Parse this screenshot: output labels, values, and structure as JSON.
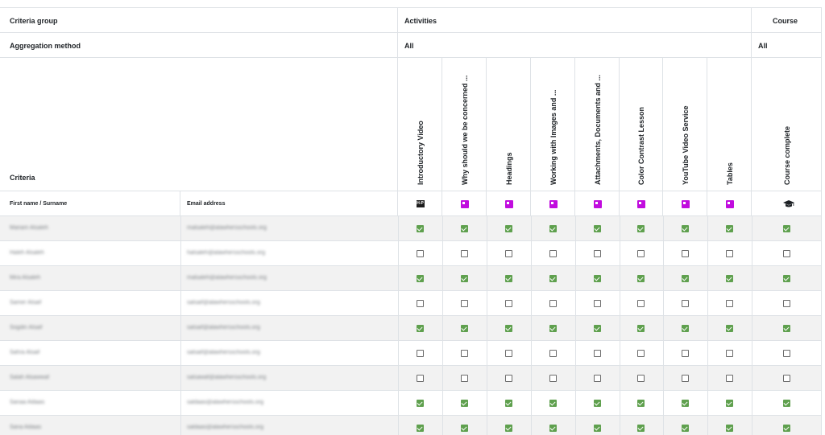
{
  "header": {
    "criteria_group_label": "Criteria group",
    "activities_label": "Activities",
    "course_label": "Course",
    "aggregation_method_label": "Aggregation method",
    "activities_aggregation": "All",
    "course_aggregation": "All",
    "criteria_label": "Criteria",
    "first_name_col": "First name / Surname",
    "email_col": "Email address"
  },
  "activities": [
    {
      "label": "Introductory Video",
      "icon": "h5p-icon"
    },
    {
      "label": "Why should we be concerned ...",
      "icon": "lesson-icon"
    },
    {
      "label": "Headings",
      "icon": "lesson-icon"
    },
    {
      "label": "Working with Images and ...",
      "icon": "lesson-icon"
    },
    {
      "label": "Attachments, Documents and ...",
      "icon": "lesson-icon"
    },
    {
      "label": "Color Contrast Lesson",
      "icon": "lesson-icon"
    },
    {
      "label": "YouTube Video Service",
      "icon": "lesson-icon"
    },
    {
      "label": "Tables",
      "icon": "lesson-icon"
    }
  ],
  "course_column": {
    "label": "Course complete",
    "icon": "graduation-cap-icon"
  },
  "h5p_icon_text": "H-P",
  "colors": {
    "complete": "#5fa04e",
    "lesson": "#c10cde",
    "row_alt": "#f2f2f2"
  },
  "users": [
    {
      "name": "Mariam Alsaleh",
      "email": "malsaleh@alawhersschools.org",
      "complete": true
    },
    {
      "name": "Haleh Alsaleh",
      "email": "halsaleh@alawhersschools.org",
      "complete": false
    },
    {
      "name": "Mira Alsaleh",
      "email": "malsaleh@alawhersschools.org",
      "complete": true
    },
    {
      "name": "Samer Alsaif",
      "email": "salsaif@alawhersschools.org",
      "complete": false
    },
    {
      "name": "Sogdin Alsaif",
      "email": "salsaif@alawhersschools.org",
      "complete": true
    },
    {
      "name": "Sahra Alsaif",
      "email": "salsaif@alawhersschools.org",
      "complete": false
    },
    {
      "name": "Salah Alsawwaf",
      "email": "salsawaf@alawhersschools.org",
      "complete": false
    },
    {
      "name": "Sanaa Aldaas",
      "email": "saldaas@alawhersschools.org",
      "complete": true
    },
    {
      "name": "Sana Aldaas",
      "email": "saldaas@alawhersschools.org",
      "complete": true
    }
  ]
}
